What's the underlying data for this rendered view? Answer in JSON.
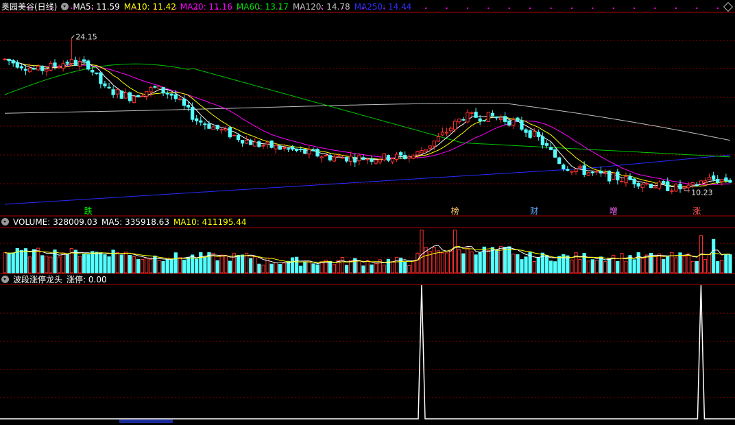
{
  "header": {
    "stock_name": "奥园美谷(日线)",
    "ma5": "MA5: 11.59",
    "ma10": "MA10: 11.42",
    "ma20": "MA20: 11.16",
    "ma60": "MA60: 13.17",
    "ma120": "MA120: 14.78",
    "ma250": "MA250: 14.44"
  },
  "volume_header": {
    "volume": "VOLUME: 328009.03",
    "ma5": "MA5: 335918.63",
    "ma10": "MA10: 411195.44"
  },
  "indicator_header": {
    "name": "波段涨停龙头",
    "value": "涨停: 0.00"
  },
  "colors": {
    "up": "#ff3232",
    "down": "#54ffff",
    "ma5": "#ffffff",
    "ma10": "#ffff00",
    "ma20": "#ff00ff",
    "ma60": "#00c800",
    "ma120": "#c0c0c0",
    "ma250": "#2a2aff",
    "grid": "#8b0000"
  },
  "chart_data": {
    "type": "candlestick",
    "annotations": {
      "high_label": "24.15",
      "low_label": "10.23",
      "event_markers": [
        {
          "label": "跌",
          "index": 20,
          "color": "#00ff00"
        },
        {
          "label": "榜",
          "index": 108,
          "color": "#ffcc66"
        },
        {
          "label": "财",
          "index": 127,
          "color": "#66aaff"
        },
        {
          "label": "增",
          "index": 146,
          "color": "#ff66ff"
        },
        {
          "label": "涨",
          "index": 166,
          "color": "#ff5555"
        }
      ]
    },
    "price_range": [
      9.0,
      26.5
    ],
    "candles": [],
    "volume": [],
    "limit_up_signal_index": [
      100,
      167
    ]
  }
}
